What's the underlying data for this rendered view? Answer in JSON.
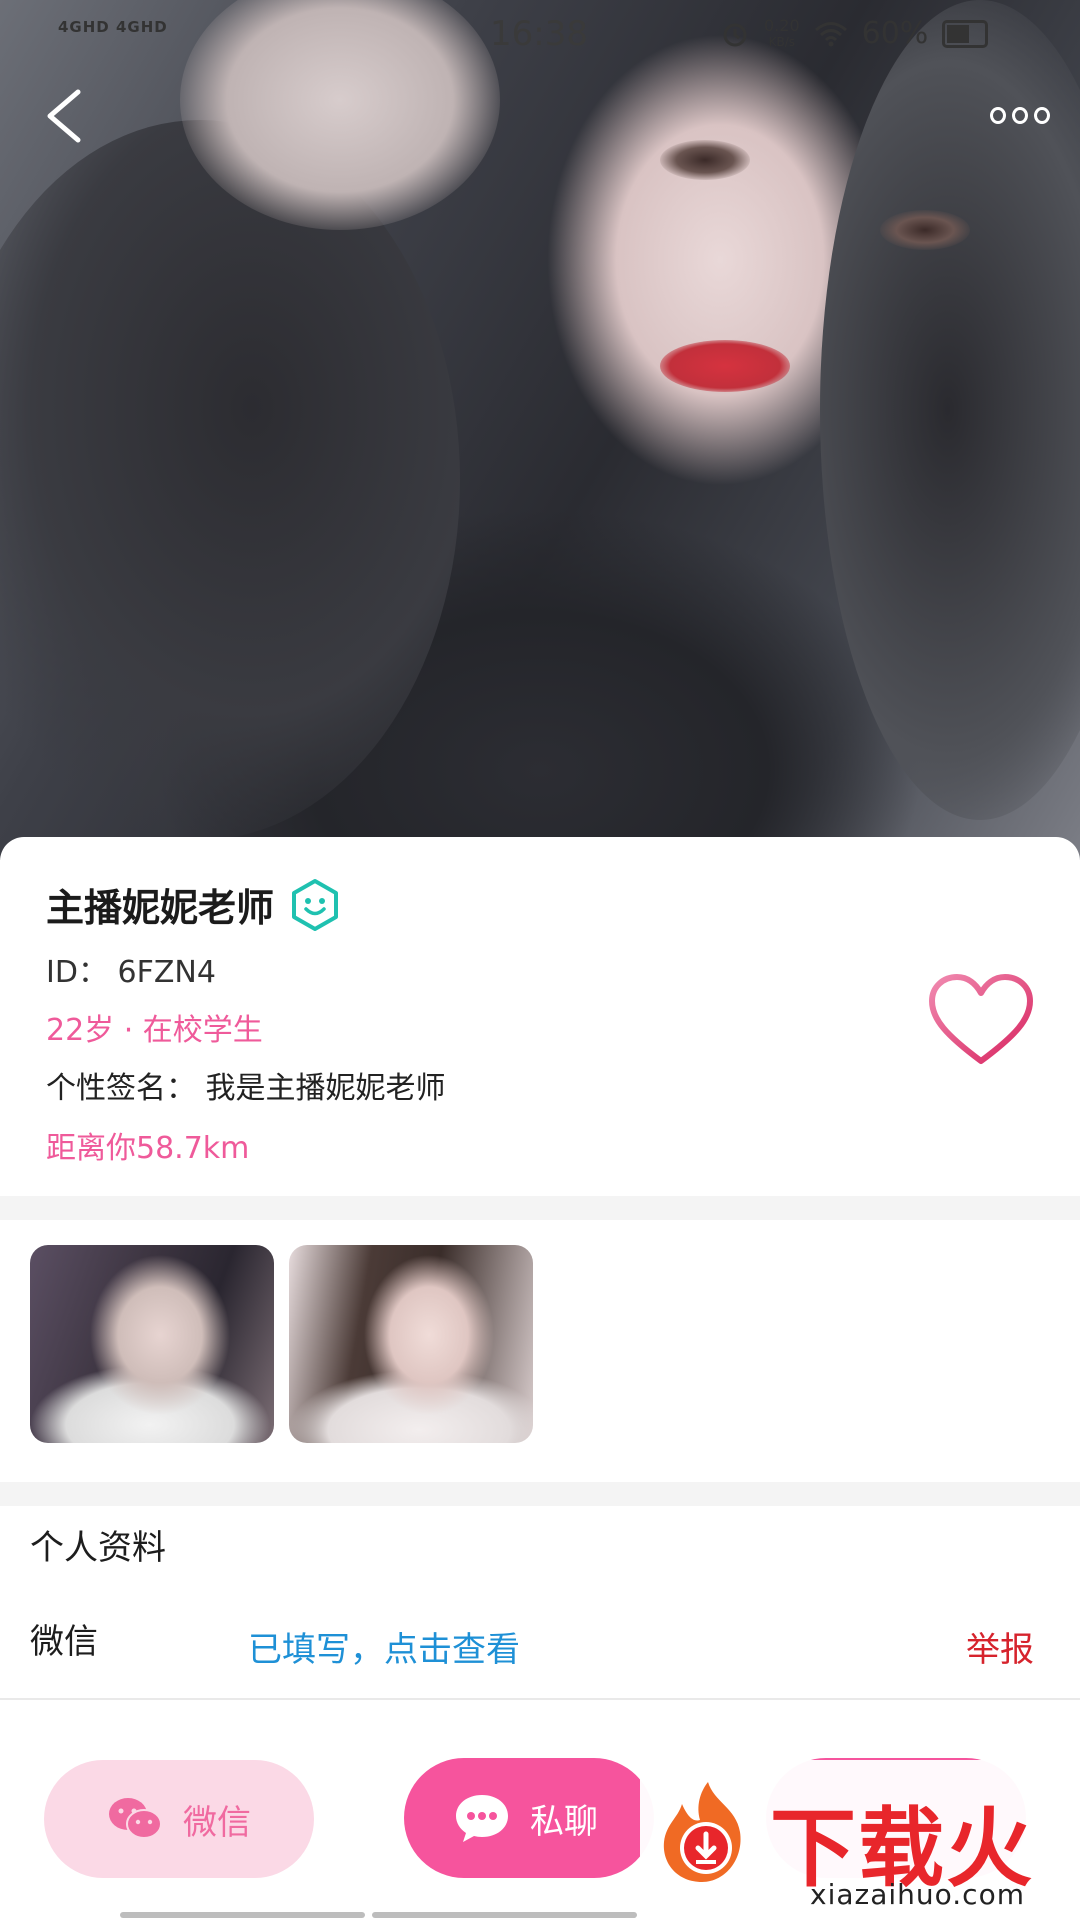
{
  "status_bar": {
    "signal": "4GHD 4GHD",
    "time": "16:38",
    "net_speed_value": "0.20",
    "net_speed_unit": "KB/s",
    "battery": "60%",
    "icons": [
      "signal-icon",
      "alarm-icon",
      "wifi-icon",
      "battery-icon"
    ]
  },
  "nav": {
    "back_icon": "chevron-left-icon",
    "more_icon": "more-dots-icon"
  },
  "profile": {
    "name": "主播妮妮老师",
    "badge_icon": "smile-face-icon",
    "id": "ID：  6FZN4",
    "age_status": "22岁 · 在校学生",
    "signature": "个性签名：  我是主播妮妮老师",
    "distance": "距离你58.7km",
    "favorite_icon": "heart-outline-icon"
  },
  "photos": {
    "items": [
      {
        "name": "photo-thumbnail-1"
      },
      {
        "name": "photo-thumbnail-2"
      }
    ]
  },
  "details": {
    "section_title": "个人资料",
    "wechat_label": "微信",
    "wechat_value": "已填写，点击查看",
    "report": "举报"
  },
  "actions": {
    "wechat_label": "微信",
    "chat_label": "私聊"
  },
  "watermark": {
    "text": "下载火",
    "url": "xiazaihuo.com"
  },
  "colors": {
    "pink_text": "#ef5a9a",
    "pink_button": "#f6549d",
    "light_pink_button": "#fbd9e6",
    "link_blue": "#1e90d6",
    "report_red": "#d6232c",
    "badge_teal": "#1fc1b0"
  }
}
